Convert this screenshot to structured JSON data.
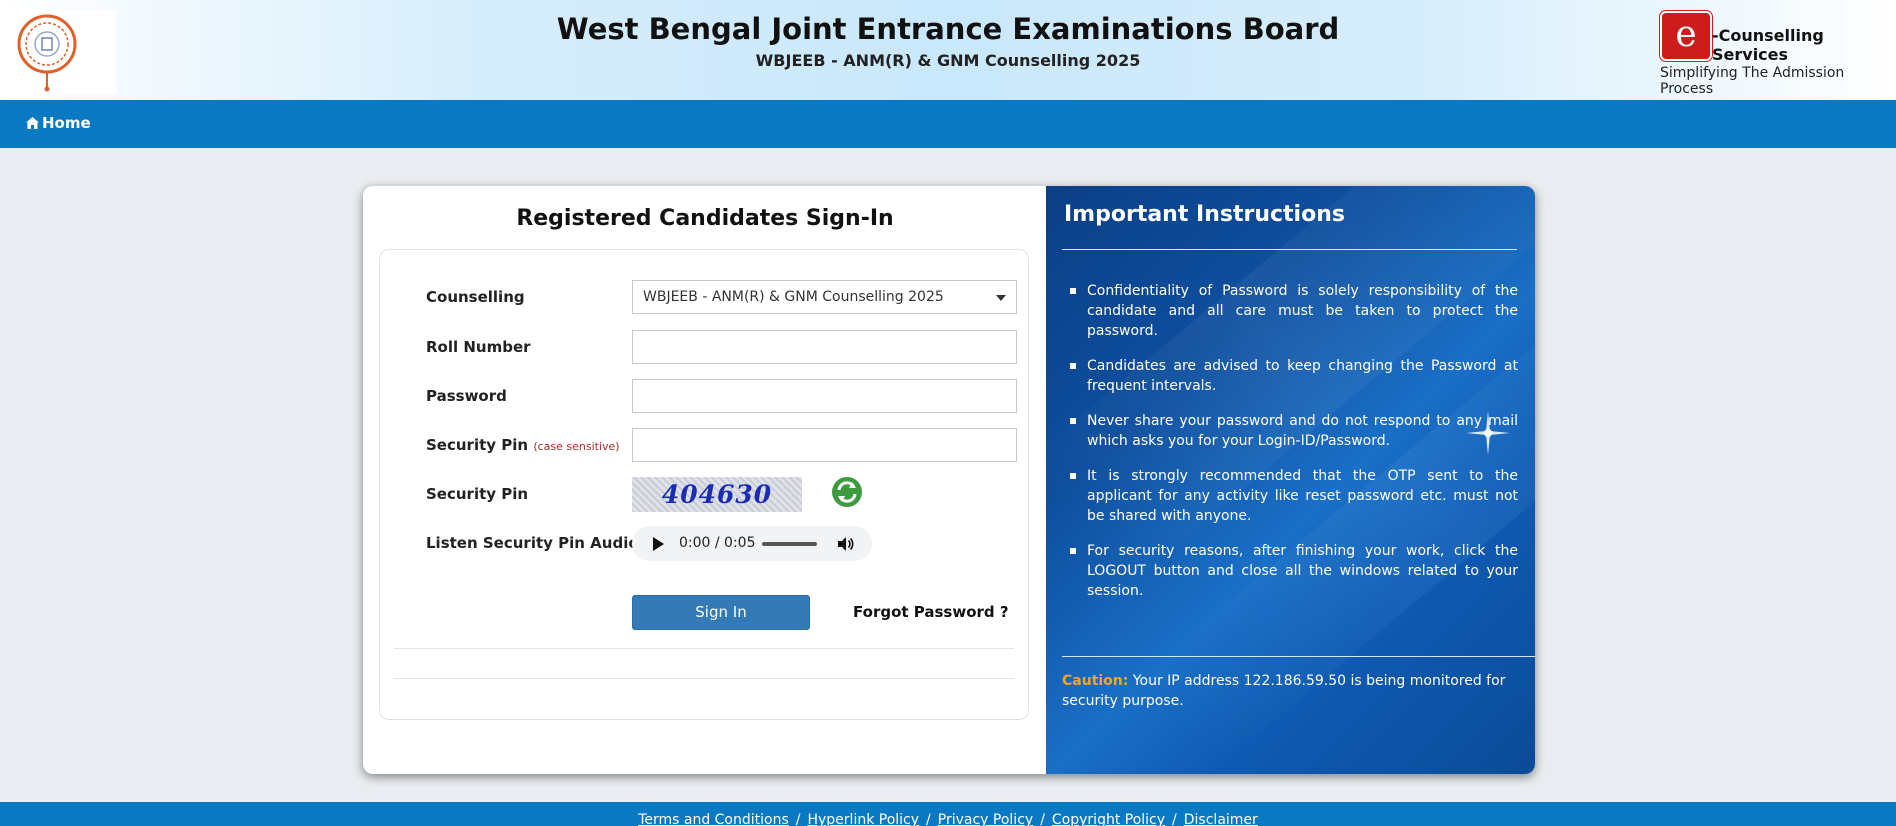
{
  "header": {
    "title": "West Bengal Joint Entrance Examinations Board",
    "subtitle": "WBJEEB - ANM(R) & GNM Counselling 2025",
    "ec_logo_letter": "e",
    "ec_service": "-Counselling Services",
    "ec_tagline": "Simplifying The Admission Process"
  },
  "nav": {
    "home_label": "Home",
    "home_icon": "home-icon"
  },
  "signin": {
    "title": "Registered Candidates Sign-In",
    "counselling_label": "Counselling",
    "counselling_value": "WBJEEB - ANM(R) & GNM Counselling 2025",
    "roll_label": "Roll Number",
    "roll_value": "",
    "password_label": "Password",
    "password_value": "",
    "pin_input_label": "Security Pin",
    "pin_hint": "(case sensitive)",
    "pin_input_value": "",
    "pin_image_label": "Security Pin",
    "captcha_text": "404630",
    "audio_label": "Listen Security Pin Audio",
    "audio_time": "0:00 / 0:05",
    "signin_button": "Sign In",
    "forgot_link": "Forgot Password ?"
  },
  "instructions": {
    "title": "Important Instructions",
    "items": [
      "Confidentiality of Password is solely responsibility of the candidate and all care must be taken to protect the password.",
      "Candidates are advised to keep changing the Password at frequent intervals.",
      "Never share your password and do not respond to any mail which asks you for your Login-ID/Password.",
      "It is strongly recommended that the OTP sent to the applicant for any activity like reset password etc. must not be shared with anyone.",
      "For security reasons, after finishing your work, click the LOGOUT button and close all the windows related to your session."
    ],
    "caution_label": "Caution:",
    "caution_text": "Your IP address 122.186.59.50 is being monitored for security purpose."
  },
  "footer": {
    "links": [
      "Terms and Conditions",
      "Hyperlink Policy",
      "Privacy Policy",
      "Copyright Policy",
      "Disclaimer"
    ],
    "separator": "/"
  },
  "colors": {
    "nav_blue": "#0a79c4",
    "button_blue": "#337ab7",
    "instructions_bg": "#0e4f9f",
    "caution_orange": "#f2a52b",
    "hint_red": "#a52a2a",
    "logo_red": "#cc1c1c"
  }
}
